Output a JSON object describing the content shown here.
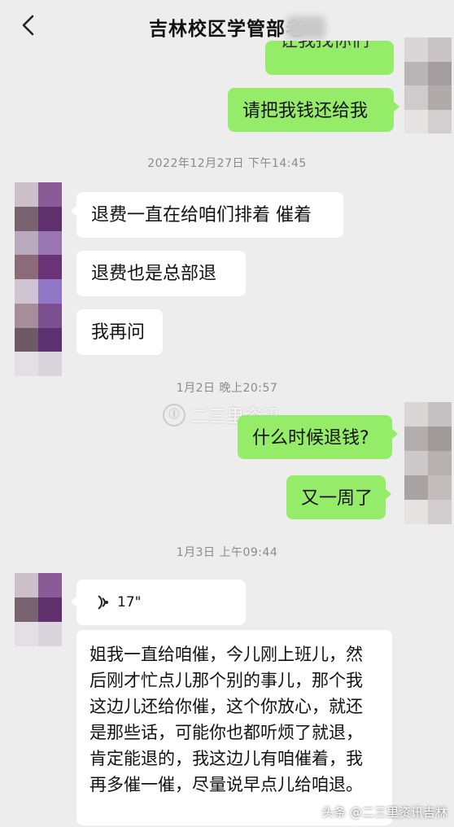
{
  "header": {
    "title": "吉林校区学管部",
    "title_suffix_blurred": "老"
  },
  "messages": {
    "m0": "让我找你们",
    "m1": "请把我钱还给我",
    "ts1": "2022年12月27日 下午14:45",
    "m2": "退费一直在给咱们排着 催着",
    "m3": "退费也是总部退",
    "m4": "我再问",
    "ts2": "1月2日 晚上20:57",
    "m5": "什么时候退钱?",
    "m6": "又一周了",
    "ts3": "1月3日 上午09:44",
    "voice_duration": "17\"",
    "m7": "姐我一直给咱催，今儿刚上班儿，然后刚才忙点儿那个别的事儿，那个我这边儿还给你催，这个你放心，就还是那些话，可能你也都听烦了就退，肯定能退的，我这边儿有咱催着，我再多催一催，尽量说早点儿给咱退。"
  },
  "watermark": {
    "text": "二三里资讯",
    "logo": "Ⓘ"
  },
  "credit": "头条 @二三里资讯吉林",
  "colors": {
    "my_bubble": "#95ec69",
    "their_bubble": "#ffffff",
    "background": "#ededed"
  }
}
